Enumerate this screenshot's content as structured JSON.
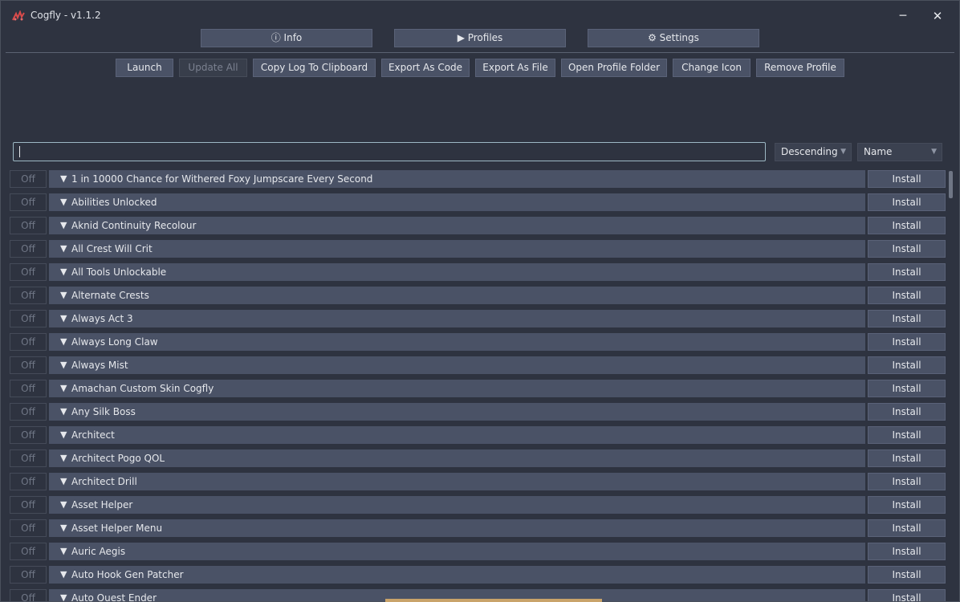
{
  "window": {
    "title": "Cogfly - v1.1.2",
    "minimize_glyph": "─",
    "close_glyph": "✕",
    "app_icon": "cogfly-logo-icon"
  },
  "nav": {
    "info": "ⓘ Info",
    "profiles": "▶ Profiles",
    "settings": "⚙ Settings"
  },
  "toolbar": {
    "launch": "Launch",
    "update_all": "Update All",
    "copy_log": "Copy Log To Clipboard",
    "export_code": "Export As Code",
    "export_file": "Export As File",
    "open_folder": "Open Profile Folder",
    "change_icon": "Change Icon",
    "remove_profile": "Remove Profile"
  },
  "search": {
    "value": "",
    "placeholder": ""
  },
  "sort": {
    "order": "Descending",
    "field": "Name",
    "arrow": "▼"
  },
  "mods": {
    "toggle_label": "Off",
    "install_label": "Install",
    "expand_glyph": "▼",
    "items": [
      "1 in 10000 Chance for Withered Foxy Jumpscare Every Second",
      "Abilities Unlocked",
      "Aknid Continuity Recolour",
      "All Crest Will Crit",
      "All Tools Unlockable",
      "Alternate Crests",
      "Always Act 3",
      "Always Long Claw",
      "Always Mist",
      "Amachan Custom Skin Cogfly",
      "Any Silk Boss",
      "Architect",
      "Architect Pogo QOL",
      "Architect Drill",
      "Asset Helper",
      "Asset Helper Menu",
      "Auric Aegis",
      "Auto Hook Gen Patcher",
      "Auto Quest Ender"
    ]
  },
  "colors": {
    "window_bg": "#2e3340",
    "button_bg": "#4a5266",
    "search_border": "#9db8c4",
    "disabled_text": "#7b8190"
  }
}
